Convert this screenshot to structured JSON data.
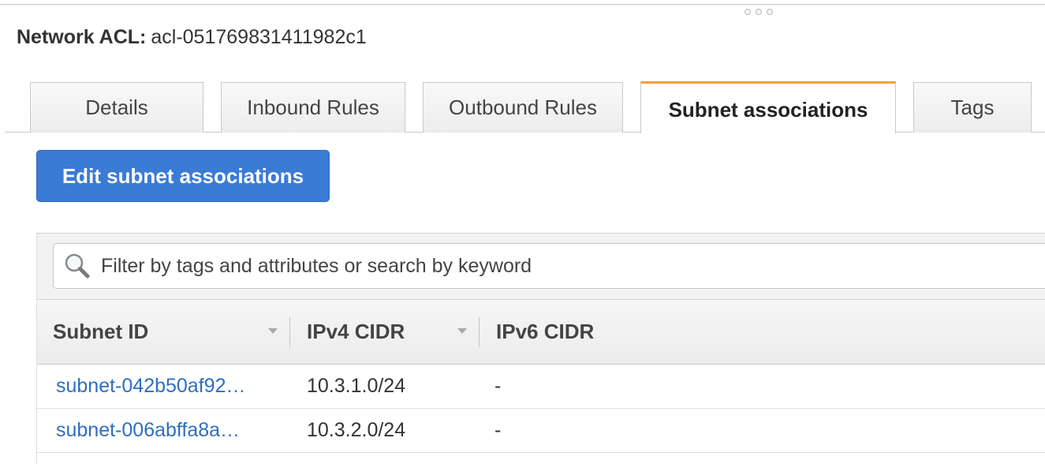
{
  "window": {
    "drag_handle_icon": "drag-handle-dots"
  },
  "header": {
    "label": "Network ACL:",
    "acl_id": "acl-051769831411982c1"
  },
  "tabs": [
    {
      "label": "Details",
      "active": false
    },
    {
      "label": "Inbound Rules",
      "active": false
    },
    {
      "label": "Outbound Rules",
      "active": false
    },
    {
      "label": "Subnet associations",
      "active": true
    },
    {
      "label": "Tags",
      "active": false
    }
  ],
  "actions": {
    "edit_label": "Edit subnet associations"
  },
  "filter": {
    "placeholder": "Filter by tags and attributes or search by keyword",
    "value": "",
    "icon": "magnifier-icon"
  },
  "table": {
    "columns": [
      {
        "label": "Subnet ID",
        "sortable": true
      },
      {
        "label": "IPv4 CIDR",
        "sortable": true
      },
      {
        "label": "IPv6 CIDR",
        "sortable": false
      }
    ],
    "rows": [
      {
        "subnet_id": "subnet-042b50af92…",
        "ipv4": "10.3.1.0/24",
        "ipv6": "-"
      },
      {
        "subnet_id": "subnet-006abffa8a…",
        "ipv4": "10.3.2.0/24",
        "ipv6": "-"
      }
    ]
  },
  "colors": {
    "accent_tab": "#f0a33a",
    "primary_button": "#3a7bd5",
    "link": "#2d6fc1"
  }
}
